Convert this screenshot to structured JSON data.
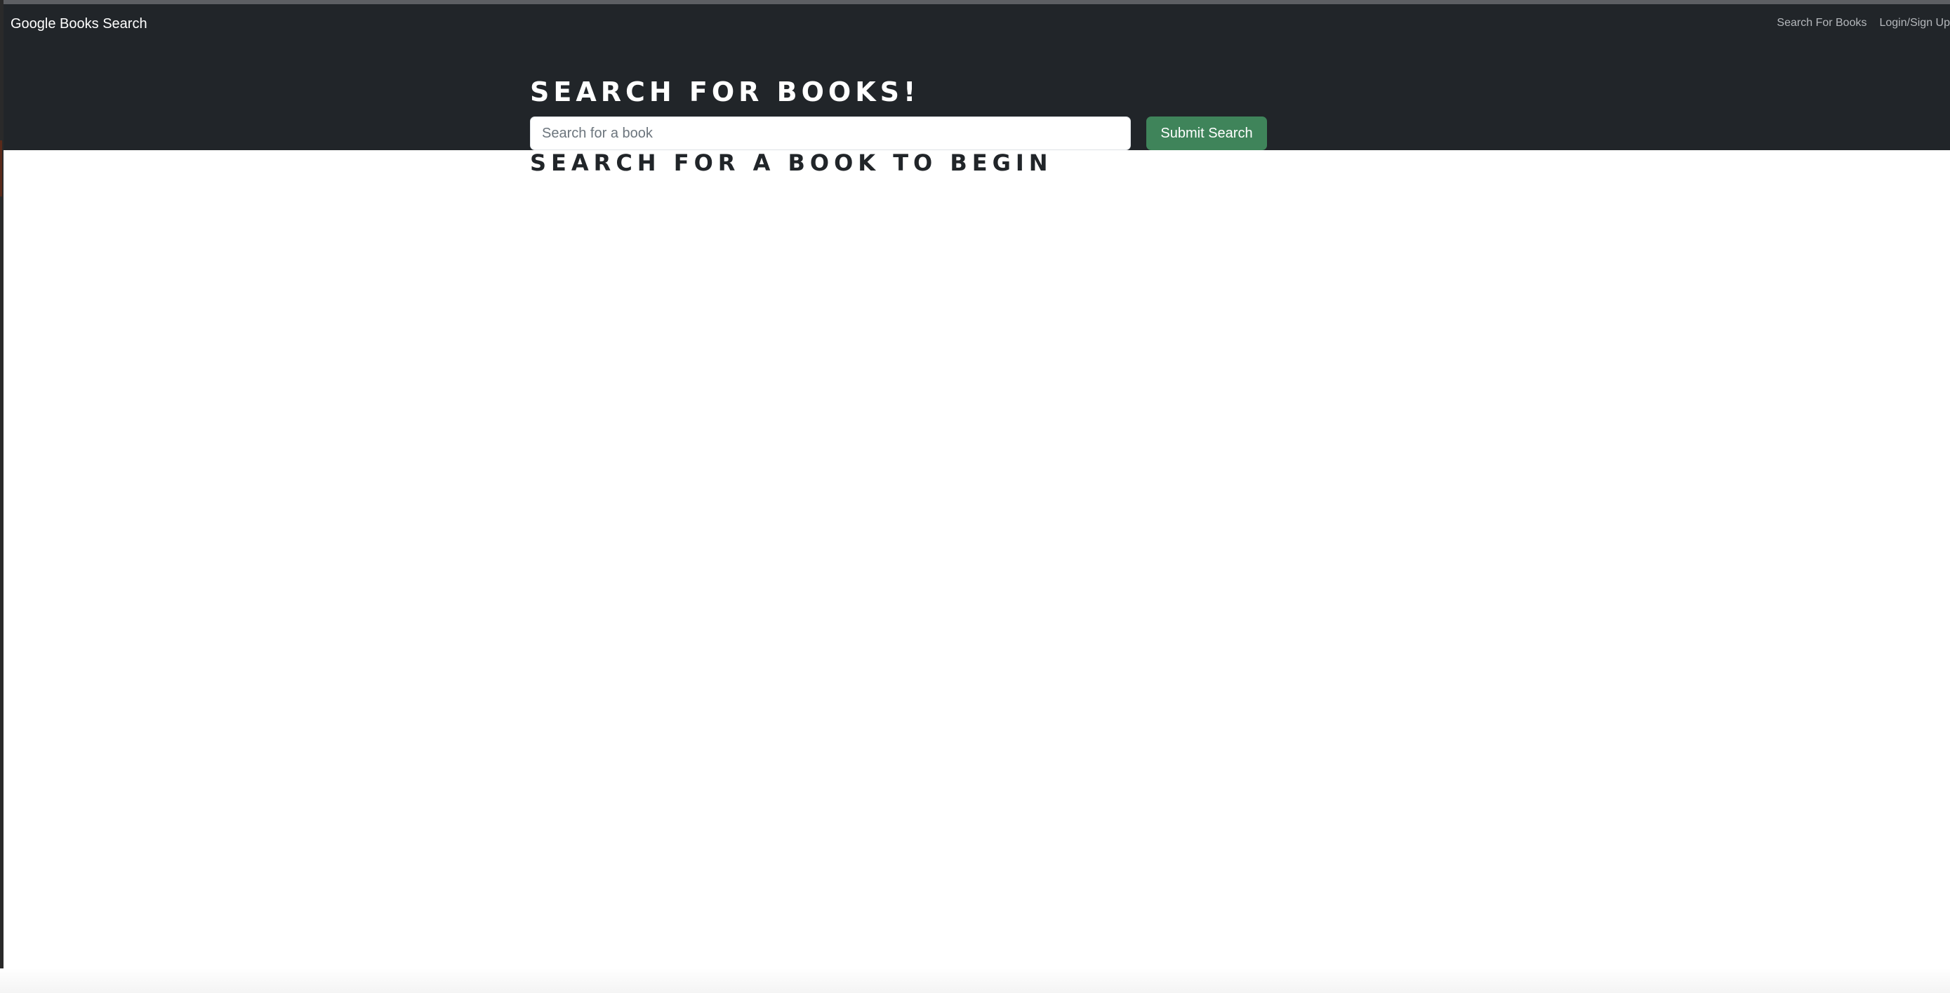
{
  "navbar": {
    "brand": "Google Books Search",
    "links": [
      {
        "label": "Search For Books"
      },
      {
        "label": "Login/Sign Up"
      }
    ]
  },
  "hero": {
    "title": "Search for Books!",
    "search": {
      "placeholder": "Search for a book",
      "value": ""
    },
    "submit_label": "Submit Search"
  },
  "results": {
    "heading": "Search for a book to begin"
  },
  "colors": {
    "navbar_bg": "#212529",
    "button_bg": "#3f845a",
    "page_bg": "#ffffff",
    "heading_text": "#212529"
  }
}
